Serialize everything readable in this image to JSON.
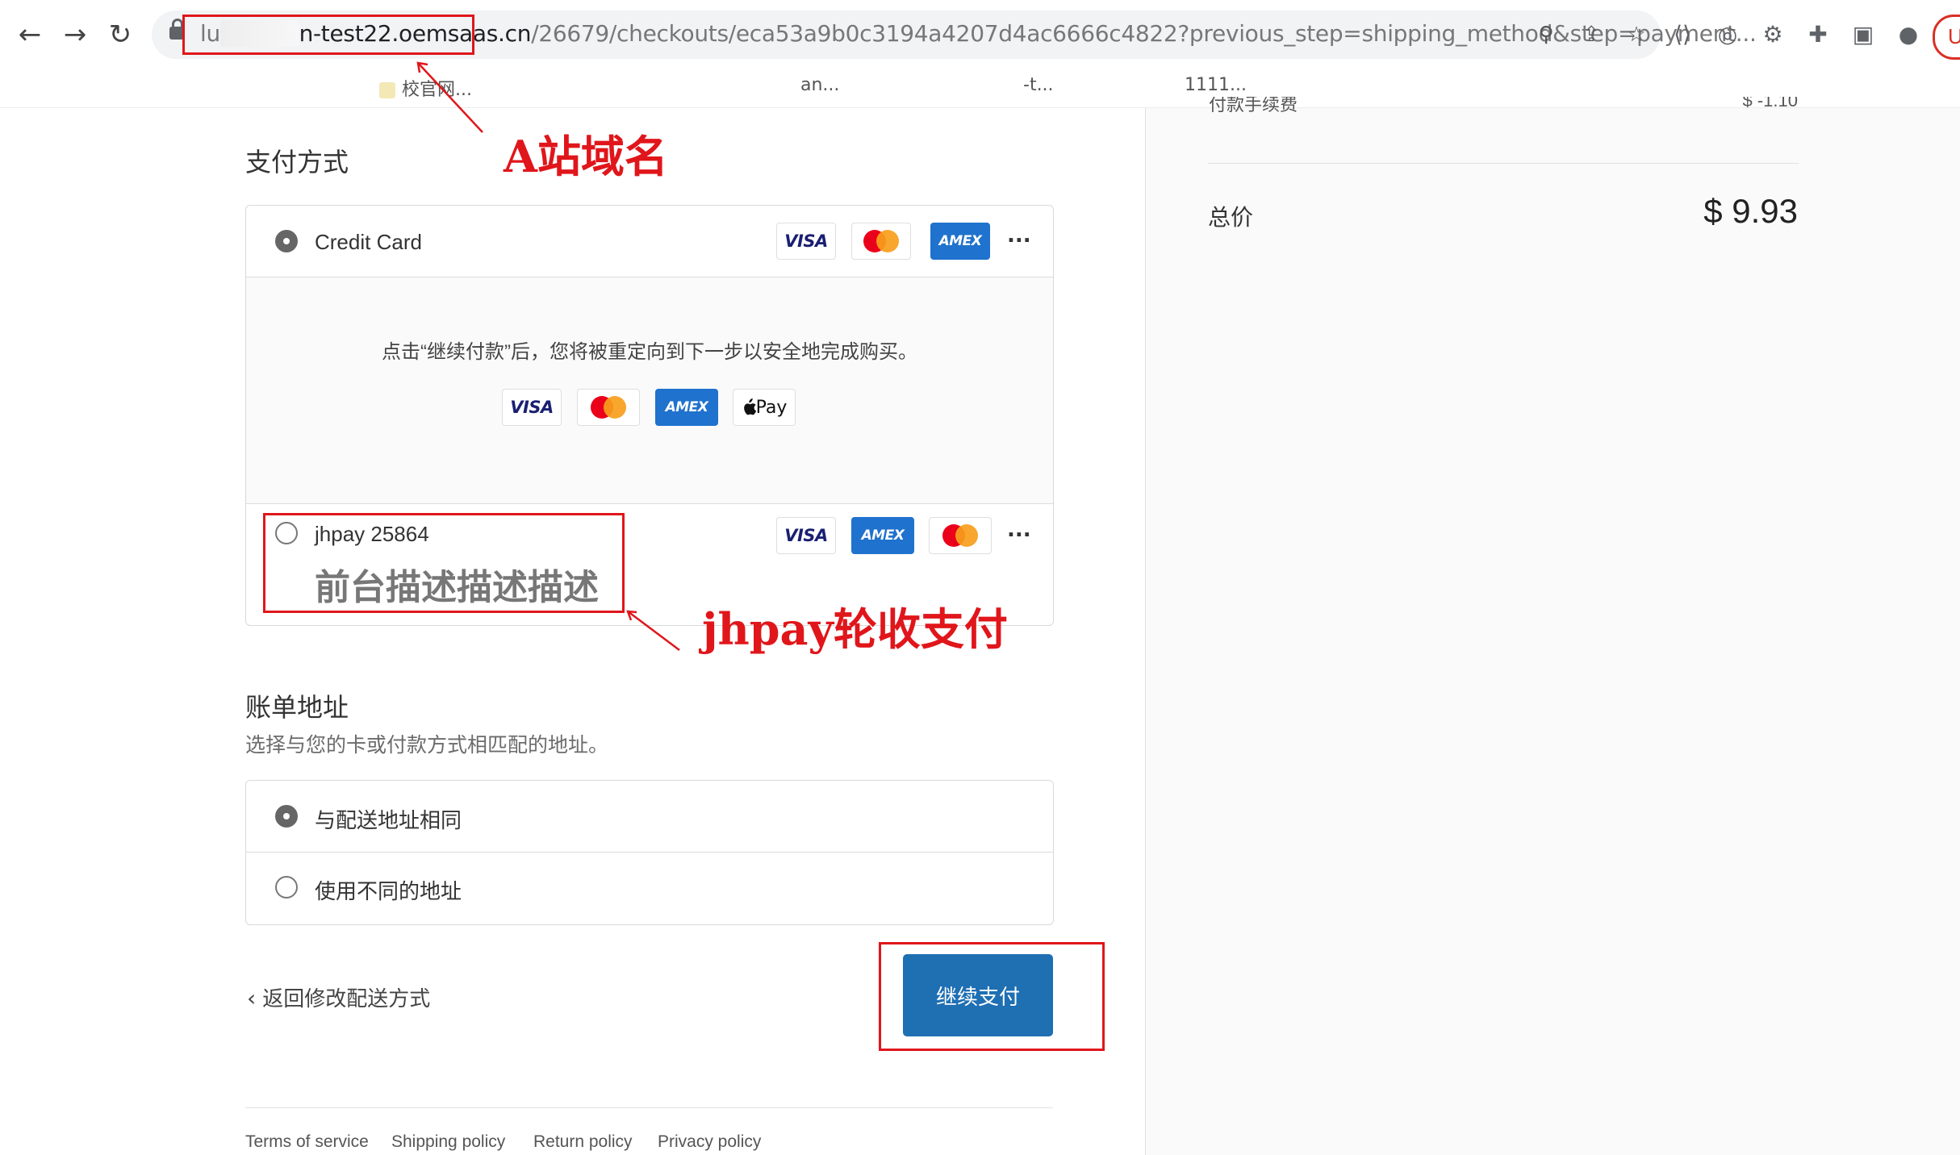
{
  "browser": {
    "url_prefix": "lu",
    "url_host": "n-test22.oemsaas.cn",
    "url_rest": "/26679/checkouts/eca53a9b0c3194a4207d4ac6666c4822?previous_step=shipping_method&step=payment...",
    "profile_initial": "U",
    "bookmarks": [
      "校官网...",
      "an...",
      "-t...",
      "1111..."
    ]
  },
  "summary": {
    "partial_label": "付款手续费",
    "partial_value": "$ -1.10",
    "total_label": "总价",
    "total_value": "$ 9.93"
  },
  "payment": {
    "title": "支付方式",
    "credit_card_label": "Credit Card",
    "redirect_text": "点击“继续付款”后，您将被重定向到下一步以安全地完成购买。",
    "jhpay_label": "jhpay 25864",
    "jhpay_description": "前台描述描述描述",
    "more": "...",
    "visa_text": "VISA",
    "amex_text": "AMEX",
    "applepay_text": "Pay",
    "applepay_logo": "apple-logo"
  },
  "billing": {
    "title": "账单地址",
    "subtitle": "选择与您的卡或付款方式相匹配的地址。",
    "option_same": "与配送地址相同",
    "option_different": "使用不同的地址"
  },
  "actions": {
    "back_label": "返回修改配送方式",
    "continue_label": "继续支付"
  },
  "footer": {
    "links": [
      "Terms of service",
      "Shipping policy",
      "Return policy",
      "Privacy policy"
    ]
  },
  "annotations": {
    "domain_note": "A站域名",
    "jhpay_note": "jhpay轮收支付",
    "color": "#e0161b"
  },
  "colors": {
    "button": "#1f6fb3",
    "visa": "#1a1f71",
    "amex": "#1f72cd"
  }
}
